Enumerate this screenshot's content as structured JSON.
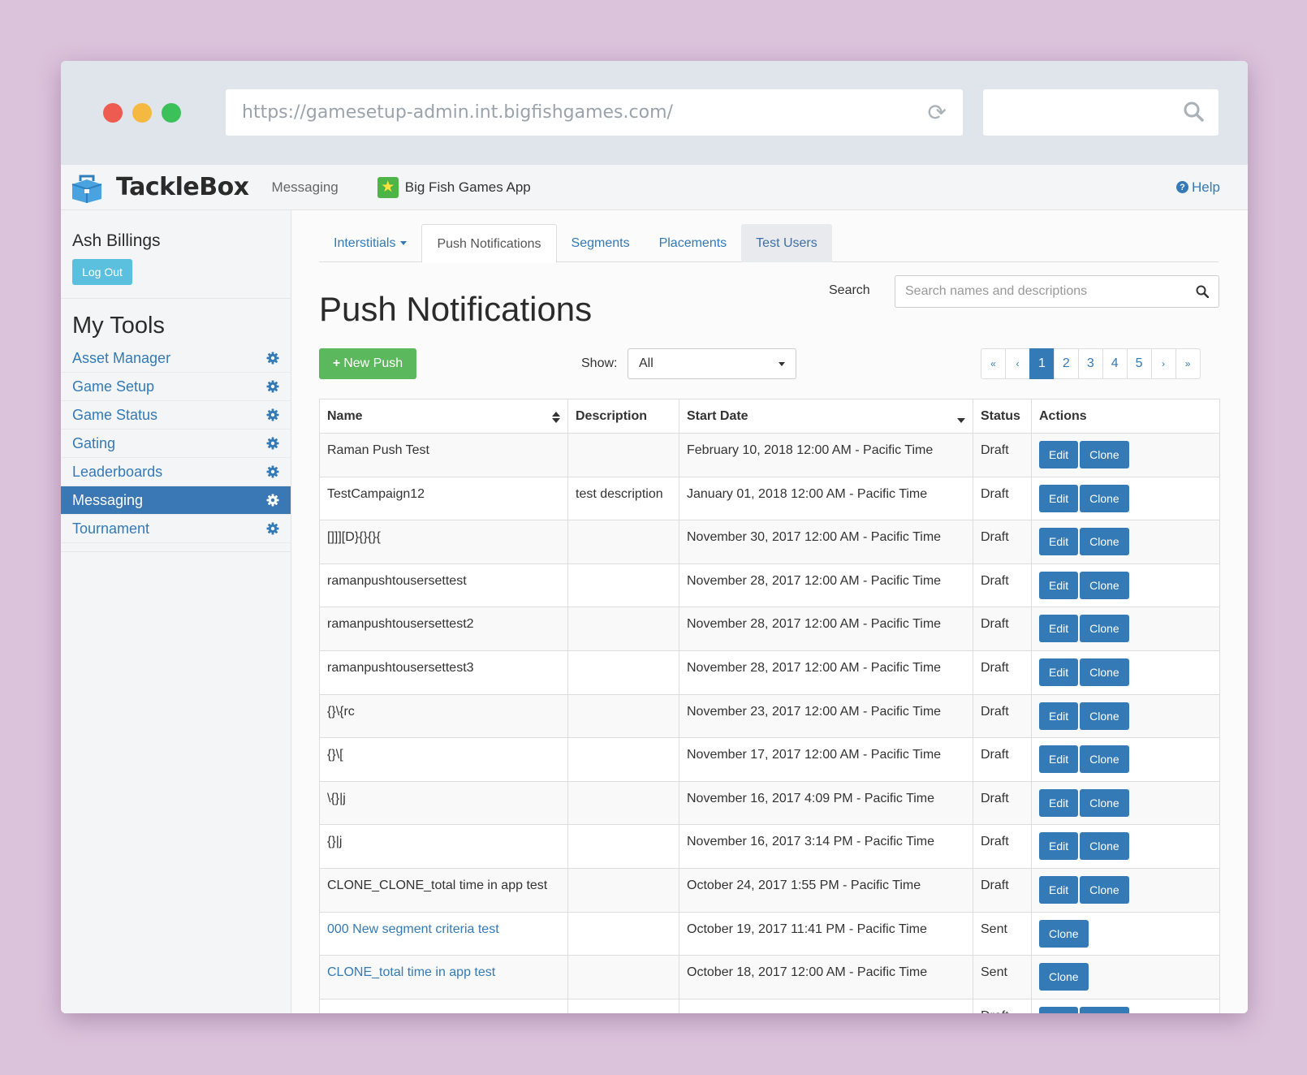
{
  "browser": {
    "url": "https://gamesetup-admin.int.bigfishgames.com/"
  },
  "navbar": {
    "brand": "TackleBox",
    "section": "Messaging",
    "app_name": "Big Fish Games App",
    "help_label": "Help"
  },
  "sidebar": {
    "user_name": "Ash Billings",
    "logout_label": "Log Out",
    "tools_title": "My Tools",
    "items": [
      {
        "label": "Asset Manager"
      },
      {
        "label": "Game Setup"
      },
      {
        "label": "Game Status"
      },
      {
        "label": "Gating"
      },
      {
        "label": "Leaderboards"
      },
      {
        "label": "Messaging",
        "active": true
      },
      {
        "label": "Tournament"
      }
    ]
  },
  "tabs": [
    "Interstitials",
    "Push Notifications",
    "Segments",
    "Placements",
    "Test Users"
  ],
  "page": {
    "title": "Push Notifications",
    "search_label": "Search",
    "search_placeholder": "Search names and descriptions",
    "new_push_label": "New Push",
    "show_label": "Show:",
    "show_value": "All"
  },
  "pagination": [
    "«",
    "‹",
    "1",
    "2",
    "3",
    "4",
    "5",
    "›",
    "»"
  ],
  "table": {
    "headers": [
      "Name",
      "Description",
      "Start Date",
      "Status",
      "Actions"
    ],
    "edit_label": "Edit",
    "clone_label": "Clone",
    "rows": [
      {
        "name": "Raman Push Test",
        "description": "",
        "start": "February 10, 2018 12:00 AM - Pacific Time",
        "status": "Draft"
      },
      {
        "name": "TestCampaign12",
        "description": "test description",
        "start": "January 01, 2018 12:00 AM - Pacific Time",
        "status": "Draft"
      },
      {
        "name": "[]]][D}{}{}{",
        "description": "",
        "start": "November 30, 2017 12:00 AM - Pacific Time",
        "status": "Draft"
      },
      {
        "name": "ramanpushtousersettest",
        "description": "",
        "start": "November 28, 2017 12:00 AM - Pacific Time",
        "status": "Draft"
      },
      {
        "name": "ramanpushtousersettest2",
        "description": "",
        "start": "November 28, 2017 12:00 AM - Pacific Time",
        "status": "Draft"
      },
      {
        "name": "ramanpushtousersettest3",
        "description": "",
        "start": "November 28, 2017 12:00 AM - Pacific Time",
        "status": "Draft"
      },
      {
        "name": "{}\\{rc",
        "description": "",
        "start": "November 23, 2017 12:00 AM - Pacific Time",
        "status": "Draft"
      },
      {
        "name": "{}\\[",
        "description": "",
        "start": "November 17, 2017 12:00 AM - Pacific Time",
        "status": "Draft"
      },
      {
        "name": "\\{}|j",
        "description": "",
        "start": "November 16, 2017 4:09 PM - Pacific Time",
        "status": "Draft"
      },
      {
        "name": "{}|j",
        "description": "",
        "start": "November 16, 2017 3:14 PM - Pacific Time",
        "status": "Draft"
      },
      {
        "name": "CLONE_CLONE_total time in app test",
        "description": "",
        "start": "October 24, 2017 1:55 PM - Pacific Time",
        "status": "Draft"
      },
      {
        "name": "000 New segment criteria test",
        "description": "",
        "start": "October 19, 2017 11:41 PM - Pacific Time",
        "status": "Sent"
      },
      {
        "name": "CLONE_total time in app test",
        "description": "",
        "start": "October 18, 2017 12:00 AM - Pacific Time",
        "status": "Sent"
      },
      {
        "name": "",
        "description": "",
        "start": "",
        "status": "Draft"
      }
    ]
  },
  "colors": {
    "primary": "#337ab7",
    "success": "#5cb85c",
    "info": "#5bc0de"
  }
}
